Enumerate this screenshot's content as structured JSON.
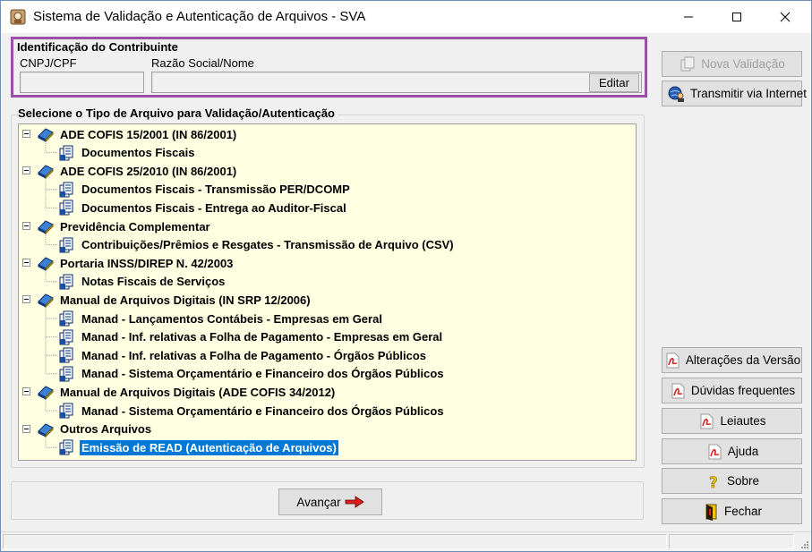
{
  "window": {
    "title": "Sistema de Validação e Autenticação de Arquivos - SVA"
  },
  "identificacao": {
    "title": "Identificação do Contribuinte",
    "cnpj_label": "CNPJ/CPF",
    "cnpj_value": "",
    "razao_label": "Razão Social/Nome",
    "razao_value": "",
    "edit_label": "Editar"
  },
  "selecao": {
    "title": "Selecione o Tipo de Arquivo para Validação/Autenticação",
    "tree": [
      {
        "label": "ADE COFIS 15/2001 (IN 86/2001)",
        "children": [
          "Documentos Fiscais"
        ]
      },
      {
        "label": "ADE COFIS 25/2010 (IN 86/2001)",
        "children": [
          "Documentos Fiscais - Transmissão PER/DCOMP",
          "Documentos Fiscais - Entrega ao Auditor-Fiscal"
        ]
      },
      {
        "label": "Previdência Complementar",
        "children": [
          "Contribuições/Prêmios e Resgates - Transmissão de Arquivo (CSV)"
        ]
      },
      {
        "label": "Portaria INSS/DIREP N. 42/2003",
        "children": [
          "Notas Fiscais de Serviços"
        ]
      },
      {
        "label": "Manual de Arquivos Digitais (IN SRP 12/2006)",
        "children": [
          "Manad - Lançamentos Contábeis - Empresas em Geral",
          "Manad - Inf. relativas a Folha de Pagamento - Empresas em Geral",
          "Manad - Inf. relativas a Folha de Pagamento - Órgãos Públicos",
          "Manad - Sistema Orçamentário e Financeiro dos Órgãos Públicos"
        ]
      },
      {
        "label": "Manual de Arquivos Digitais (ADE COFIS 34/2012)",
        "children": [
          "Manad - Sistema Orçamentário e Financeiro dos Órgãos Públicos"
        ]
      },
      {
        "label": "Outros Arquivos",
        "children": [
          "Emissão de READ (Autenticação de Arquivos)"
        ]
      }
    ],
    "selected": "Emissão de READ (Autenticação de Arquivos)"
  },
  "buttons": {
    "nova_validacao": "Nova Validação",
    "transmitir": "Transmitir via Internet",
    "alteracoes": "Alterações da Versão",
    "duvidas": "Dúvidas frequentes",
    "leiautes": "Leiautes",
    "ajuda": "Ajuda",
    "sobre": "Sobre",
    "fechar": "Fechar",
    "avancar": "Avançar"
  },
  "colors": {
    "highlight_frame": "#9b4fa8",
    "tree_background": "#ffffe1",
    "selection": "#0078d7",
    "pdf_red": "#d9201e"
  }
}
